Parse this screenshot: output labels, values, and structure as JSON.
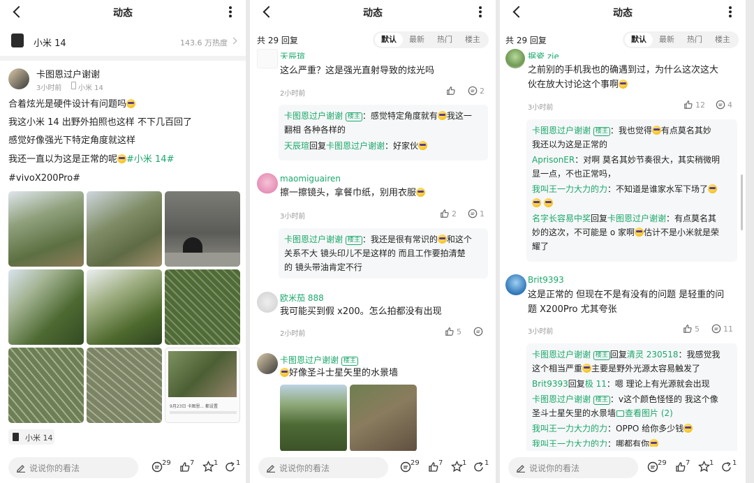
{
  "header_title": "动态",
  "panel1": {
    "topic": {
      "name": "小米 14",
      "heat": "143.6 万热度"
    },
    "post": {
      "author": "卡图恩过户谢谢",
      "time": "3小时前",
      "device": "小米 14",
      "lines": [
        "合着炫光是硬件设计有问题吗",
        "我这小米 14 出野外拍照也这样 不下几百回了",
        "感觉好像强光下特定角度就这样",
        "我还一直以为这是正常的呢"
      ],
      "tag1": "#小米 14#",
      "tag2": "#vivoX200Pro#",
      "device_chip": "小米 14",
      "screenshot_caption": "9月23日 卡图恩... 都设置"
    }
  },
  "panel2": {
    "count": "共 29 回复",
    "tabs": [
      "默认",
      "最新",
      "热门",
      "楼主"
    ],
    "c1": {
      "name": "天辰瑄",
      "text": "这么严重？这是强光直射导致的炫光吗",
      "time": "2小时前",
      "likes": "",
      "replies": "2",
      "reply1_name": "卡图恩过户谢谢",
      "reply1_badge": "楼主",
      "reply1_text_a": "：感觉特定角度就有",
      "reply1_text_b": "我这一",
      "reply1_text_c": "翻相 各种各样的",
      "reply2_name": "天辰瑄",
      "reply2_mid": "回复",
      "reply2_to": "卡图恩过户谢谢",
      "reply2_text": "：好家伙"
    },
    "c2": {
      "name": "maomiguairen",
      "text": "擦一擦镜头，拿餐巾纸，别用衣服",
      "time": "3小时前",
      "likes": "2",
      "replies": "1",
      "reply1_name": "卡图恩过户谢谢",
      "reply1_badge": "楼主",
      "reply1_text_a": "：我还是很有常识的",
      "reply1_text_b": "和这个",
      "reply1_text_c": "关系不大 镜头印儿不是这样的 而且工作要拍清楚",
      "reply1_text_d": "的 镜头带油肯定不行"
    },
    "c3": {
      "name": "欧米茄 888",
      "text": "我可能买到假 x200。怎么拍都没有出现",
      "time": "2小时前",
      "likes": "5",
      "replies": ""
    },
    "c4": {
      "name": "卡图恩过户谢谢",
      "badge": "楼主",
      "text": "好像圣斗士星矢里的水景墙"
    }
  },
  "panel3": {
    "count": "共 29 回复",
    "tabs": [
      "默认",
      "最新",
      "热门",
      "楼主"
    ],
    "c1": {
      "name": "据瓷 zie",
      "text_a": "之前别的手机我也的确遇到过，为什么这次这大",
      "text_b": "伙在放大讨论这个事啊",
      "time": "3小时前",
      "likes": "12",
      "replies": "4",
      "r1_name": "卡图恩过户谢谢",
      "r1_badge": "楼主",
      "r1_text_a": "：我也觉得",
      "r1_text_b": "有点莫名其妙",
      "r1_text_c": "我还以为这是正常的",
      "r2_name": "AprisonER",
      "r2_text_a": "：对啊 莫名其妙节奏很大，其实稍微明",
      "r2_text_b": "显一点，不也正常吗，",
      "r3_name": "我叫王一力大力的力",
      "r3_text": "：不知道是谁家水军下场了",
      "r4_name": "名字长容易中奖",
      "r4_mid": "回复",
      "r4_to": "卡图恩过户谢谢",
      "r4_text_a": "：有点莫名其",
      "r4_text_b": "妙的这次，不可能是 o 家啊",
      "r4_text_c": "估计不是小米就是荣",
      "r4_text_d": "耀了"
    },
    "c2": {
      "name": "Brit9393",
      "text_a": "这是正常的 但现在不是有没有的问题 是轻重的问",
      "text_b": "题 X200Pro 尤其夸张",
      "time": "3小时前",
      "likes": "5",
      "replies": "11",
      "r1_name": "卡图恩过户谢谢",
      "r1_badge": "楼主",
      "r1_mid": "回复",
      "r1_to": "清灵 230518",
      "r1_text_a": "：我感觉我",
      "r1_text_b": "这个相当严重",
      "r1_text_c": "主要是野外光源太容易触发了",
      "r2_name": "Brit9393",
      "r2_mid": "回复",
      "r2_to": "极 11",
      "r2_text": "：嗯 理论上有光源就会出现",
      "r3_name": "卡图恩过户谢谢",
      "r3_badge": "楼主",
      "r3_text_a": "：v这个颜色怪怪的 我这个像",
      "r3_text_b": "圣斗士星矢里的水景墙",
      "r3_link": "查看图片 (2)",
      "r4_name": "我叫王一力大力的力",
      "r4_text": "：OPPO 给你多少钱",
      "r5_name": "我叫王一力大力的力",
      "r5_text": "：哪都有你"
    }
  },
  "bottom": {
    "placeholder": "说说你的看法",
    "comments": "29",
    "likes": "7",
    "stars": "1",
    "shares": "1"
  }
}
